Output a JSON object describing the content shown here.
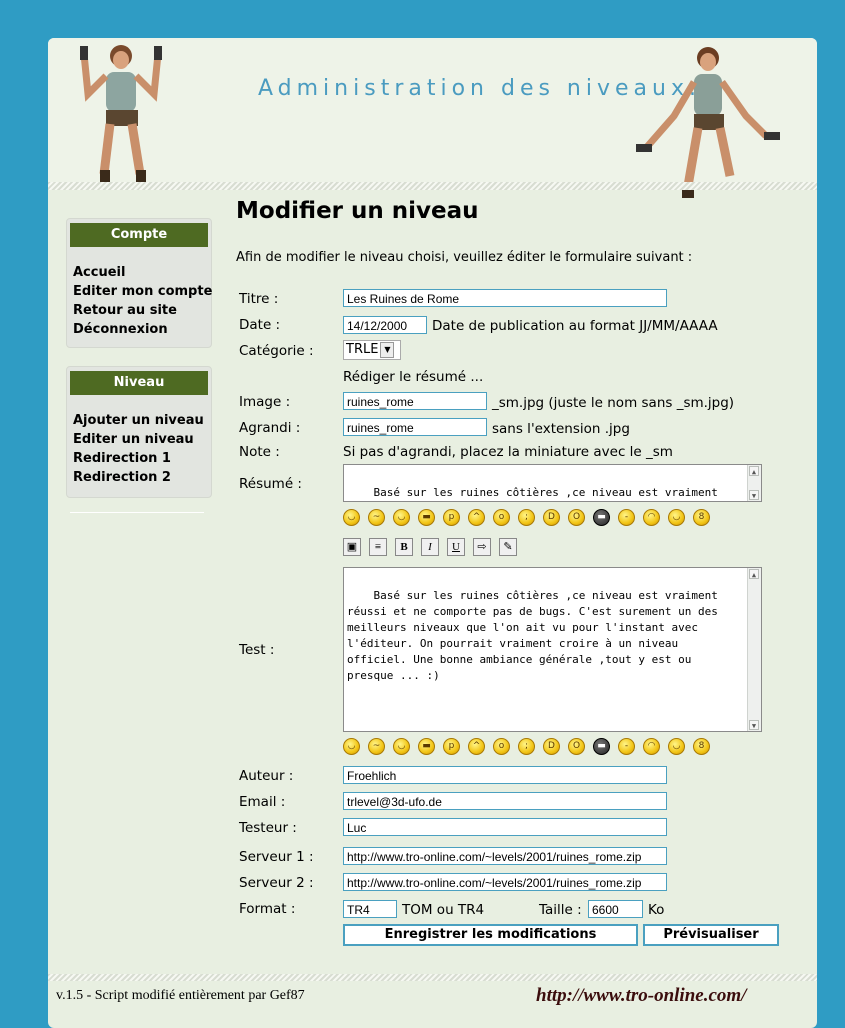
{
  "banner": {
    "title": "Administration des niveaux..."
  },
  "sidebar": {
    "compte": {
      "title": "Compte",
      "items": [
        "Accueil",
        "Editer mon compte",
        "Retour au site",
        "Déconnexion"
      ]
    },
    "niveau": {
      "title": "Niveau",
      "items": [
        "Ajouter un niveau",
        "Editer un niveau",
        "Redirection 1",
        "Redirection 2"
      ]
    }
  },
  "main": {
    "title": "Modifier un niveau",
    "intro": "Afin de modifier le niveau choisi, veuillez éditer le formulaire suivant :"
  },
  "form": {
    "titre": {
      "label": "Titre :",
      "value": "Les Ruines de Rome"
    },
    "date": {
      "label": "Date :",
      "value": "14/12/2000",
      "hint": "Date de publication au format JJ/MM/AAAA"
    },
    "categorie": {
      "label": "Catégorie :",
      "value": "TRLE"
    },
    "resume_link": "Rédiger le résumé ...",
    "image": {
      "label": "Image :",
      "value": "ruines_rome",
      "hint": "_sm.jpg (juste le nom sans _sm.jpg)"
    },
    "agrandi": {
      "label": "Agrandi :",
      "value": "ruines_rome",
      "hint": "sans l'extension .jpg"
    },
    "note": {
      "label": "Note :",
      "value": "Si pas d'agrandi, placez la miniature avec le _sm"
    },
    "resume": {
      "label": "Résumé :",
      "value": "Basé sur les ruines côtières ,ce niveau est vraiment réussi et ne comporte pas de bugs. c'est"
    },
    "test": {
      "label": "Test :",
      "value": "Basé sur les ruines côtières ,ce niveau est vraiment réussi et ne comporte pas de bugs. C'est surement un des meilleurs niveaux que l'on ait vu pour l'instant avec l'éditeur. On pourrait vraiment croire à un niveau officiel. Une bonne ambiance générale ,tout y est ou presque ... :)"
    },
    "auteur": {
      "label": "Auteur :",
      "value": "Froehlich"
    },
    "email": {
      "label": "Email :",
      "value": "trlevel@3d-ufo.de"
    },
    "testeur": {
      "label": "Testeur :",
      "value": "Luc"
    },
    "serveur1": {
      "label": "Serveur 1 :",
      "value": "http://www.tro-online.com/~levels/2001/ruines_rome.zip"
    },
    "serveur2": {
      "label": "Serveur 2 :",
      "value": "http://www.tro-online.com/~levels/2001/ruines_rome.zip"
    },
    "format": {
      "label": "Format :",
      "value": "TR4",
      "hint": "TOM ou TR4"
    },
    "taille": {
      "label": "Taille :",
      "value": "6600",
      "unit": "Ko"
    },
    "save_label": "Enregistrer les modifications",
    "preview_label": "Prévisualiser"
  },
  "smilies": [
    "smile-icon",
    "confused-icon",
    "happy-icon",
    "grin-icon",
    "tongue-icon",
    "angry-icon",
    "rolleyes-icon",
    "wink-icon",
    "laugh-icon",
    "surprised-icon",
    "cool-icon",
    "sleepy-icon",
    "sad-icon",
    "smile2-icon",
    "glasses-icon"
  ],
  "toolbar_icons": [
    "image-icon",
    "align-center-icon",
    "bold-icon",
    "italic-icon",
    "underline-icon",
    "link-icon",
    "email-icon"
  ],
  "footer": {
    "left": "v.1.5 - Script modifié entièrement par Gef87",
    "right": "http://www.tro-online.com/"
  }
}
